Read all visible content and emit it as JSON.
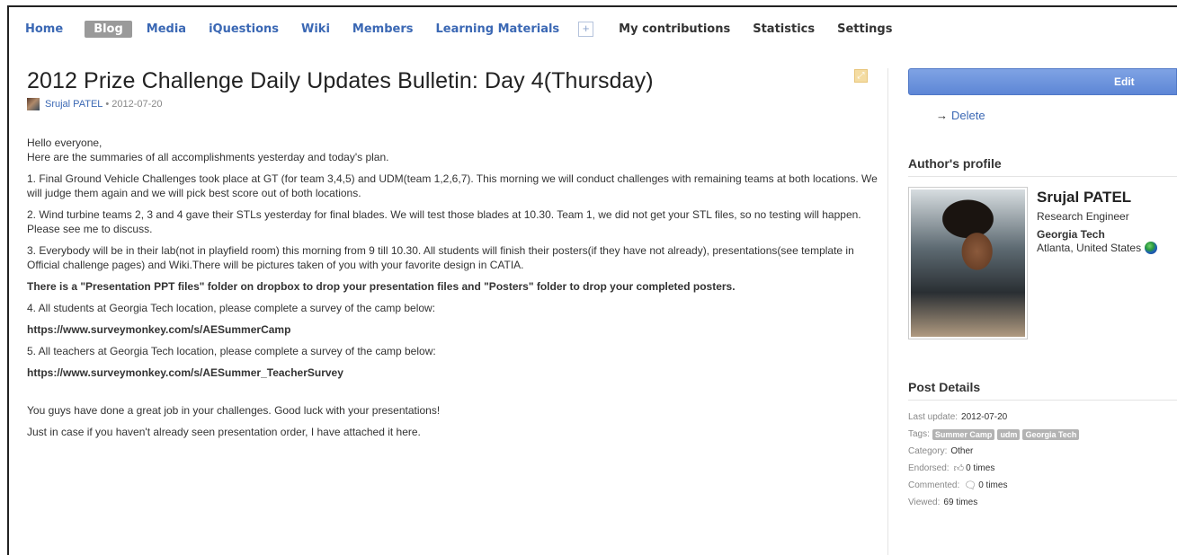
{
  "nav": {
    "items": [
      {
        "label": "Home",
        "active": false
      },
      {
        "label": "Blog",
        "active": true
      },
      {
        "label": "Media",
        "active": false
      },
      {
        "label": "iQuestions",
        "active": false
      },
      {
        "label": "Wiki",
        "active": false
      },
      {
        "label": "Members",
        "active": false
      },
      {
        "label": "Learning Materials",
        "active": false
      }
    ],
    "plus": "+",
    "secondary": [
      "My contributions",
      "Statistics",
      "Settings"
    ]
  },
  "post": {
    "title": "2012 Prize Challenge Daily Updates Bulletin: Day 4(Thursday)",
    "author": "Srujal PATEL",
    "separator": "•",
    "date": "2012-07-20",
    "greeting_1": "Hello everyone,",
    "greeting_2": "Here are the summaries of all accomplishments yesterday and today's plan.",
    "p1": "1. Final Ground Vehicle Challenges took place at GT (for team 3,4,5) and UDM(team 1,2,6,7). This morning we will conduct challenges with remaining teams at both locations. We will judge them again and we will pick best score out of both locations.",
    "p2": "2. Wind turbine teams 2, 3 and 4 gave their STLs yesterday for final blades. We will test those blades at 10.30. Team 1, we did not get your STL files, so no testing will happen. Please see me to discuss.",
    "p3": "3. Everybody will be in their lab(not in playfield room) this morning from 9 till 10.30. All students will finish their posters(if they have not already), presentations(see template in Official challenge pages) and Wiki.There will be pictures taken of you with your favorite design in CATIA.",
    "p_bold": "There is a \"Presentation PPT files\" folder on dropbox to drop your presentation files and \"Posters\" folder to drop your completed posters.",
    "p4": "4. All students at Georgia Tech location, please complete a survey of the camp below:",
    "link1": "https://www.surveymonkey.com/s/AESummerCamp",
    "p5": "5. All teachers at Georgia Tech location, please complete a survey of the camp below:",
    "link2": "https://www.surveymonkey.com/s/AESummer_TeacherSurvey",
    "p6": "You guys have done a great job in your challenges. Good luck with your presentations!",
    "p7": "Just in case if you haven't already seen presentation order, I have attached it here."
  },
  "sidebar": {
    "edit_label": "Edit",
    "delete_arrow": "→",
    "delete_label": "Delete",
    "author_heading": "Author's profile",
    "profile": {
      "name": "Srujal PATEL",
      "role": "Research Engineer",
      "org": "Georgia Tech",
      "location": "Atlanta, United States"
    },
    "details_heading": "Post Details",
    "details": {
      "last_update_label": "Last update:",
      "last_update": "2012-07-20",
      "tags_label": "Tags:",
      "tags": [
        "Summer Camp",
        "udm",
        "Georgia Tech"
      ],
      "category_label": "Category:",
      "category": "Other",
      "endorsed_label": "Endorsed:",
      "endorsed": "0 times",
      "commented_label": "Commented:",
      "commented": "0 times",
      "viewed_label": "Viewed:",
      "viewed": "69 times"
    }
  }
}
